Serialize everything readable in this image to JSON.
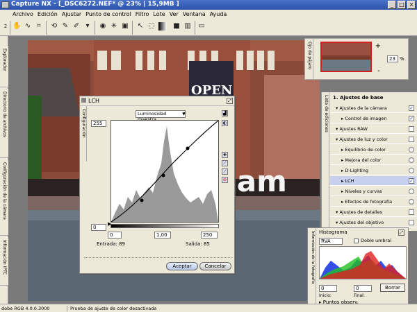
{
  "window": {
    "title": "Capture NX - [_DSC6272.NEF* @ 23% | 15,9MB ]",
    "min": "_",
    "max": "□",
    "close": "×"
  },
  "menu": [
    "Archivo",
    "Edición",
    "Ajustar",
    "Punto de control",
    "Filtro",
    "Lote",
    "Ver",
    "Ventana",
    "Ayuda"
  ],
  "toolbar": {
    "page_num": "2",
    "icons": [
      "hand-icon",
      "zoom-icon",
      "rotate-icon",
      "crop-icon",
      "straighten-icon",
      "brush-icon",
      "lasso-icon",
      "selection-icon",
      "gradient-icon"
    ]
  },
  "left_tabs": [
    "Explorador",
    "Directorio de archivos",
    "Configuración de la cámara",
    "Información IPTC"
  ],
  "photo": {
    "banner": "OPEN",
    "sculpture": "rdam"
  },
  "birdseye": {
    "label": "Ojo de pájaro",
    "zoom": "23",
    "unit": "%",
    "plus": "+",
    "minus": "-"
  },
  "edit_list": {
    "label": "Lista de ediciones",
    "header": "1. Ajustes de base",
    "items": [
      {
        "label": "Ajustes de la cámara",
        "indent": 1,
        "ctl": "check",
        "checked": true
      },
      {
        "label": "Control de imagen",
        "indent": 2,
        "ctl": "check",
        "checked": true
      },
      {
        "label": "Ajustes RAW",
        "indent": 1,
        "ctl": "check",
        "checked": false
      },
      {
        "label": "Ajustes de luz y color",
        "indent": 1,
        "ctl": "check",
        "checked": false
      },
      {
        "label": "Equilibrio de color",
        "indent": 2,
        "ctl": "radio",
        "checked": false
      },
      {
        "label": "Mejora del color",
        "indent": 2,
        "ctl": "radio",
        "checked": false
      },
      {
        "label": "D-Lighting",
        "indent": 2,
        "ctl": "radio",
        "checked": false
      },
      {
        "label": "LCH",
        "indent": 2,
        "ctl": "check",
        "checked": true,
        "selected": true
      },
      {
        "label": "Niveles y curvas",
        "indent": 2,
        "ctl": "radio",
        "checked": false
      },
      {
        "label": "Efectos de fotografía",
        "indent": 2,
        "ctl": "radio",
        "checked": false
      },
      {
        "label": "Ajustes de detalles",
        "indent": 1,
        "ctl": "check",
        "checked": false
      },
      {
        "label": "Ajustes del objetivo",
        "indent": 1,
        "ctl": "check",
        "checked": false
      }
    ]
  },
  "histogram": {
    "panel_label": "Información de la fotografía",
    "title": "Histograma",
    "channel": "RVA",
    "double_threshold": "Doble umbral",
    "start_value": "0",
    "end_value": "0",
    "start_label": "Inicio:",
    "end_label": "Final:",
    "clear": "Borrar",
    "points": "Puntos observ."
  },
  "lch": {
    "title": "LCH",
    "side_label": "Configuración",
    "channel": "Luminosidad maestra",
    "top_value": "255",
    "bottom_value": "0",
    "in_left": "0",
    "gamma": "1,00",
    "in_right": "250",
    "input_label": "Entrada: 89",
    "output_label": "Salida: 85",
    "ok": "Aceptar",
    "cancel": "Cancelar"
  },
  "status": {
    "profile": "dobe RGB 4.0.0.3000",
    "softproof": "Prueba de ajuste de color desactivada"
  },
  "colors": {
    "titlebar": "#2a52a8",
    "panel": "#ece9d8",
    "selected_row": "#c8d0f0",
    "accent": "#1a3fa8"
  }
}
